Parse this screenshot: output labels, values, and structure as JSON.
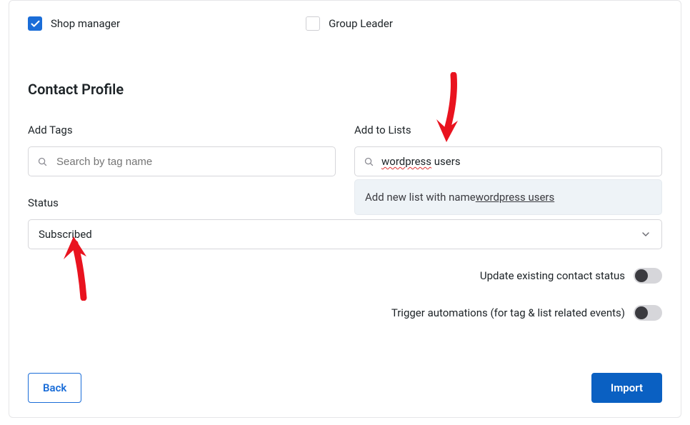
{
  "roles": {
    "shop_manager": {
      "label": "Shop manager",
      "checked": true
    },
    "group_leader": {
      "label": "Group Leader",
      "checked": false
    }
  },
  "section_title": "Contact Profile",
  "tags": {
    "label": "Add Tags",
    "placeholder": "Search by tag name",
    "value": ""
  },
  "lists": {
    "label": "Add to Lists",
    "value_part1": "wordpress",
    "value_part2": " users",
    "suggestion_prefix": "Add new list with name ",
    "suggestion_name": "wordpress users"
  },
  "status": {
    "label": "Status",
    "selected": "Subscribed"
  },
  "toggles": {
    "update_status": {
      "label": "Update existing contact status",
      "on": false
    },
    "trigger_automations": {
      "label": "Trigger automations (for tag & list related events)",
      "on": false
    }
  },
  "footer": {
    "back": "Back",
    "import": "Import"
  },
  "colors": {
    "primary": "#0a60c2",
    "checkbox": "#1a6dd8",
    "arrow": "#e9131f"
  }
}
